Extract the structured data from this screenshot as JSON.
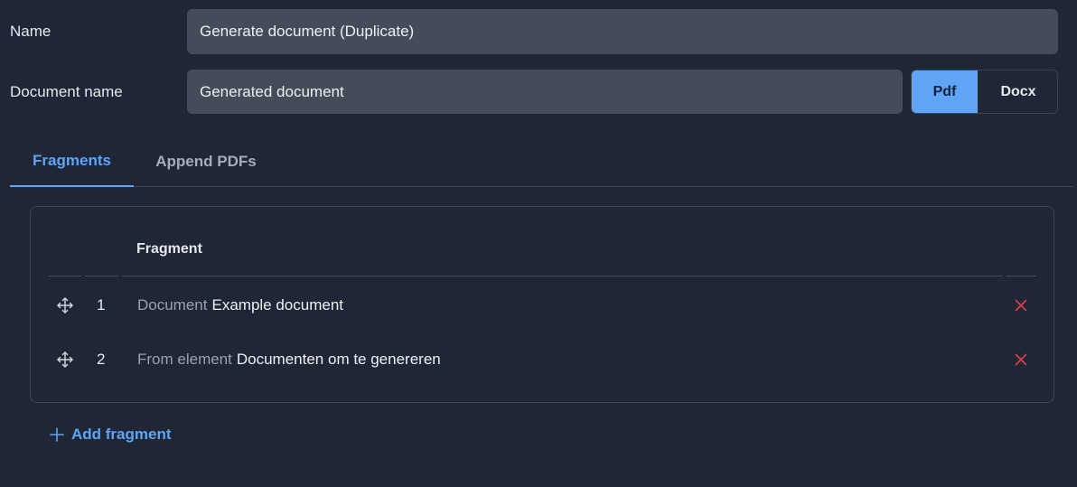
{
  "form": {
    "name_label": "Name",
    "name_value": "Generate document  (Duplicate)",
    "docname_label": "Document name",
    "docname_value": "Generated document",
    "format_options": [
      "Pdf",
      "Docx"
    ],
    "format_selected": "Pdf"
  },
  "tabs": [
    {
      "label": "Fragments",
      "active": true
    },
    {
      "label": "Append PDFs",
      "active": false
    }
  ],
  "fragments_table": {
    "header": "Fragment",
    "rows": [
      {
        "index": "1",
        "type": "Document",
        "value": "Example document"
      },
      {
        "index": "2",
        "type": "From element",
        "value": "Documenten om te genereren"
      }
    ]
  },
  "add_fragment_label": "Add fragment",
  "colors": {
    "background": "#1f2636",
    "accent": "#5fa4f5",
    "input_bg": "#444b59",
    "remove": "#e0424d"
  },
  "icons": {
    "drag": "move-arrows-icon",
    "remove": "close-icon",
    "add": "plus-icon"
  }
}
